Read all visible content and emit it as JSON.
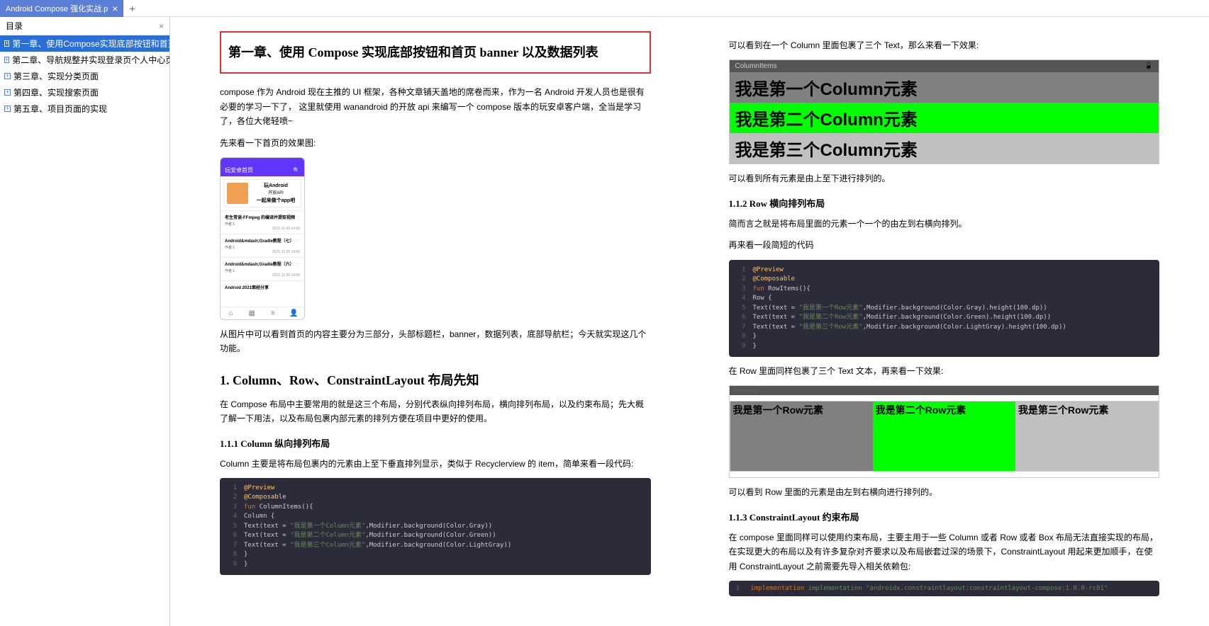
{
  "tab": {
    "title": "Android Compose 强化实战.p",
    "close": "×",
    "add": "+"
  },
  "toc": {
    "header": "目录",
    "items": [
      "第一章、使用Compose实现底部按钮和首页",
      "第二章、导航规整并实现登录页个人中心页",
      "第三章、实现分类页面",
      "第四章、实现搜索页面",
      "第五章、项目页面的实现"
    ]
  },
  "page1": {
    "title": "第一章、使用 Compose 实现底部按钮和首页 banner 以及数据列表",
    "intro": "compose 作为 Android 现在主推的 UI 框架，各种文章铺天盖地的席卷而来，作为一名 Android 开发人员也是很有必要的学习一下了， 这里就使用 wanandroid 的开放 api 来编写一个 compose 版本的玩安卓客户端，全当是学习了，各位大佬轻喷~",
    "intro2": "先来看一下首页的效果图:",
    "phone": {
      "header_left": "玩安卓首页",
      "header_right": "🔍",
      "banner_title": "玩Android",
      "banner_sub": "开放API",
      "banner_cta": "一起来做个app吧",
      "cards": [
        {
          "title": "老生常谈-FFmpeg 的编译并提取视频",
          "author": "作者:1",
          "date": "2021-11-26 14:56"
        },
        {
          "title": "Android&mdash;Gradle教程（七）",
          "author": "作者:1",
          "date": "2021-11-26 14:56"
        },
        {
          "title": "Android&mdash;Gradle教程（六）",
          "author": "作者:1",
          "date": "2021-11-26 14:56"
        },
        {
          "title": "Android 2021面经分享",
          "author": "",
          "date": ""
        }
      ]
    },
    "after_img": "从图片中可以看到首页的内容主要分为三部分，头部标题栏，banner，数据列表，底部导航栏；今天就实现这几个功能。",
    "h1": "1. Column、Row、ConstraintLayout 布局先知",
    "h1_p": "在 Compose 布局中主要常用的就是这三个布局，分别代表纵向排列布局，横向排列布局，以及约束布局；先大概了解一下用法，以及布局包裹内部元素的排列方便在项目中更好的使用。",
    "h2_1": "1.1.1 Column 纵向排列布局",
    "h2_1_p": "Column 主要是将布局包裹内的元素由上至下垂直排列显示，类似于 Recyclerview 的 item，简单来看一段代码:",
    "code1": {
      "lines": [
        {
          "n": "1",
          "t": "@Preview",
          "cls": "kw-yellow"
        },
        {
          "n": "2",
          "t": "@Composable",
          "cls": "kw-yellow"
        },
        {
          "n": "3",
          "html": "<span class='kw-orange'>fun</span> ColumnItems(){"
        },
        {
          "n": "4",
          "t": "    Column {",
          "cls": ""
        },
        {
          "n": "5",
          "html": "        Text(text = <span class='kw-green'>\"我是第一个Column元素\"</span>,Modifier.background(Color.Gray))"
        },
        {
          "n": "6",
          "html": "        Text(text = <span class='kw-green'>\"我是第二个Column元素\"</span>,Modifier.background(Color.Green))"
        },
        {
          "n": "7",
          "html": "        Text(text = <span class='kw-green'>\"我是第三个Column元素\"</span>,Modifier.background(Color.LightGray))"
        },
        {
          "n": "8",
          "t": "    }",
          "cls": ""
        },
        {
          "n": "9",
          "t": "}",
          "cls": ""
        }
      ]
    }
  },
  "page2": {
    "p1": "可以看到在一个 Column 里面包裹了三个 Text，那么来看一下效果:",
    "col_header": "ColumnItems",
    "col_items": [
      "我是第一个Column元素",
      "我是第二个Column元素",
      "我是第三个Column元素"
    ],
    "p2": "可以看到所有元素是由上至下进行排列的。",
    "h2_2": "1.1.2 Row 横向排列布局",
    "h2_2_p": "简而言之就是将布局里面的元素一个一个的由左到右横向排列。",
    "h2_2_p2": "再来看一段简短的代码",
    "code2": {
      "lines": [
        {
          "n": "1",
          "t": "@Preview",
          "cls": "kw-yellow"
        },
        {
          "n": "2",
          "t": "@Composable",
          "cls": "kw-yellow"
        },
        {
          "n": "3",
          "html": "<span class='kw-orange'>fun</span> RowItems(){"
        },
        {
          "n": "4",
          "t": "    Row {",
          "cls": ""
        },
        {
          "n": "5",
          "html": "        Text(text = <span class='kw-green'>\"我是第一个Row元素\"</span>,Modifier.background(Color.Gray).height(100.dp))"
        },
        {
          "n": "6",
          "html": "        Text(text = <span class='kw-green'>\"我是第二个Row元素\"</span>,Modifier.background(Color.Green).height(100.dp))"
        },
        {
          "n": "7",
          "html": "        Text(text = <span class='kw-green'>\"我是第三个Row元素\"</span>,Modifier.background(Color.LightGray).height(100.dp))"
        },
        {
          "n": "8",
          "t": "    }",
          "cls": ""
        },
        {
          "n": "9",
          "t": "}",
          "cls": ""
        }
      ]
    },
    "p3": "在 Row 里面同样包裹了三个 Text 文本，再来看一下效果:",
    "row_header": "RowItems",
    "row_items": [
      "我是第一个Row元素",
      "我是第二个Row元素",
      "我是第三个Row元素"
    ],
    "p4": "可以看到 Row 里面的元素是由左到右横向进行排列的。",
    "h2_3": "1.1.3 ConstraintLayout 约束布局",
    "h2_3_p": "在 compose 里面同样可以使用约束布局，主要主用于一些 Column 或者 Row 或者 Box 布局无法直接实现的布局，在实现更大的布局以及有许多复杂对齐要求以及布局嵌套过深的场景下，ConstraintLayout 用起来更加顺手，在使用 ConstraintLayout 之前需要先导入相关依赖包:",
    "dep_code": "implementation \"androidx.constraintlayout:constraintlayout-compose:1.0.0-rc01\""
  }
}
